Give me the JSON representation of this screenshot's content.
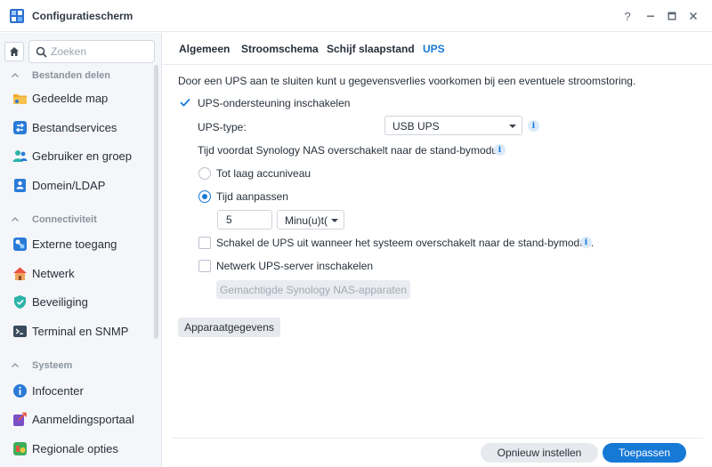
{
  "window": {
    "title": "Configuratiescherm",
    "help": "?"
  },
  "sidebar": {
    "search_placeholder": "Zoeken",
    "sections": [
      {
        "label": "Bestanden delen",
        "items": [
          {
            "label": "Gedeelde map",
            "icon": "shared-folder-icon"
          },
          {
            "label": "Bestandservices",
            "icon": "file-services-icon"
          },
          {
            "label": "Gebruiker en groep",
            "icon": "user-group-icon"
          },
          {
            "label": "Domein/LDAP",
            "icon": "domain-ldap-icon"
          }
        ]
      },
      {
        "label": "Connectiviteit",
        "items": [
          {
            "label": "Externe toegang",
            "icon": "external-access-icon"
          },
          {
            "label": "Netwerk",
            "icon": "network-icon"
          },
          {
            "label": "Beveiliging",
            "icon": "security-shield-icon"
          },
          {
            "label": "Terminal en SNMP",
            "icon": "terminal-icon"
          }
        ]
      },
      {
        "label": "Systeem",
        "items": [
          {
            "label": "Infocenter",
            "icon": "info-center-icon"
          },
          {
            "label": "Aanmeldingsportaal",
            "icon": "login-portal-icon"
          },
          {
            "label": "Regionale opties",
            "icon": "regional-options-icon"
          }
        ]
      }
    ]
  },
  "tabs": [
    {
      "label": "Algemeen",
      "active": false
    },
    {
      "label": "Stroomschema",
      "active": false
    },
    {
      "label": "Schijf slaapstand",
      "active": false
    },
    {
      "label": "UPS",
      "active": true
    }
  ],
  "ups": {
    "description": "Door een UPS aan te sluiten kunt u gegevensverlies voorkomen bij een eventuele stroomstoring.",
    "enable_label": "UPS-ondersteuning inschakelen",
    "enable_checked": true,
    "type_label": "UPS-type:",
    "type_value": "USB UPS",
    "standby_label": "Tijd voordat Synology NAS overschakelt naar de stand-bymodus",
    "option_low_battery": "Tot laag accuniveau",
    "option_custom_time": "Tijd aanpassen",
    "selected_option": "custom_time",
    "time_value": "5",
    "time_unit": "Minu(u)t(",
    "shutdown_ups_label": "Schakel de UPS uit wanneer het systeem overschakelt naar de stand-bymodus.",
    "shutdown_ups_checked": false,
    "network_server_label": "Netwerk UPS-server inschakelen",
    "network_server_checked": false,
    "permitted_devices_button": "Gemachtigde Synology NAS-apparaten",
    "device_info_button": "Apparaatgegevens"
  },
  "footer": {
    "reset_label": "Opnieuw instellen",
    "apply_label": "Toepassen"
  },
  "colors": {
    "accent": "#1679d6"
  }
}
